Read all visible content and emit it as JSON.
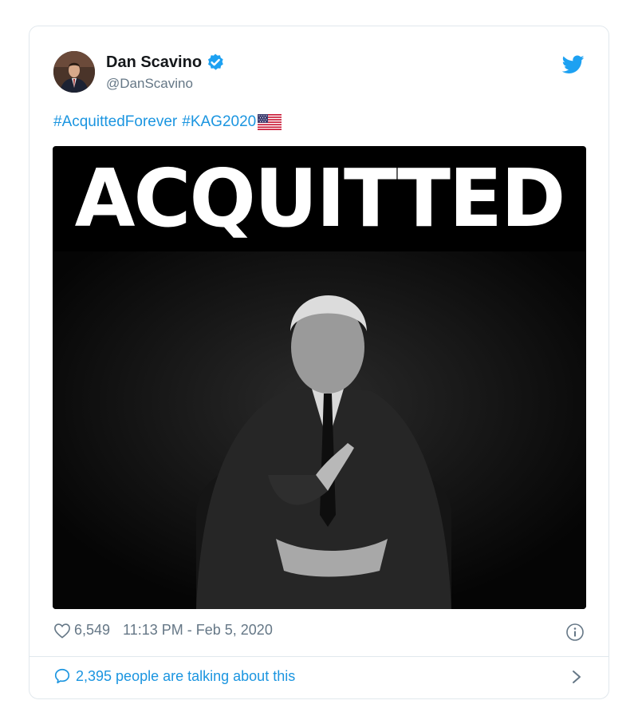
{
  "tweet": {
    "author_name": "Dan Scavino",
    "handle": "@DanScavino",
    "verified": true,
    "hashtags": [
      "#AcquittedForever",
      "#KAG2020"
    ],
    "media": {
      "headline": "ACQUITTED"
    },
    "likes": "6,549",
    "timestamp": "11:13 PM - Feb 5, 2020",
    "conversation_text": "2,395 people are talking about this"
  },
  "icons": {
    "verified": "verified-badge-icon",
    "brand": "twitter-bird-icon",
    "flag": "us-flag-emoji",
    "like": "heart-icon",
    "info": "info-icon",
    "reply": "speech-bubble-icon",
    "chevron": "chevron-right-icon"
  },
  "colors": {
    "link": "#1b95e0",
    "muted": "#657786",
    "text": "#14171a",
    "border": "#e1e8ed"
  }
}
